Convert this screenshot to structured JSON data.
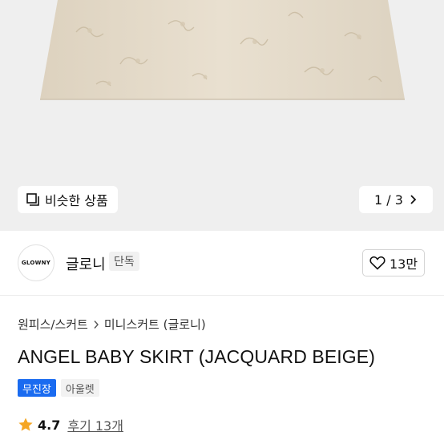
{
  "gallery": {
    "similar_label": "비슷한 상품",
    "pager_text": "1 / 3"
  },
  "brand": {
    "logo_text": "GLOWNY",
    "name": "글로니",
    "badge": "단독",
    "like_count": "13만"
  },
  "breadcrumb": {
    "items": [
      "원피스/스커트",
      "미니스커트 (글로니)"
    ]
  },
  "product": {
    "title": "ANGEL BABY SKIRT (JACQUARD BEIGE)",
    "tags": [
      "무진장",
      "아울렛"
    ]
  },
  "rating": {
    "score": "4.7",
    "reviews": "후기 13개"
  },
  "colors": {
    "accent_blue": "#1a6bf0",
    "star": "#f5a623",
    "skirt_beige": "#e7ddcc"
  }
}
